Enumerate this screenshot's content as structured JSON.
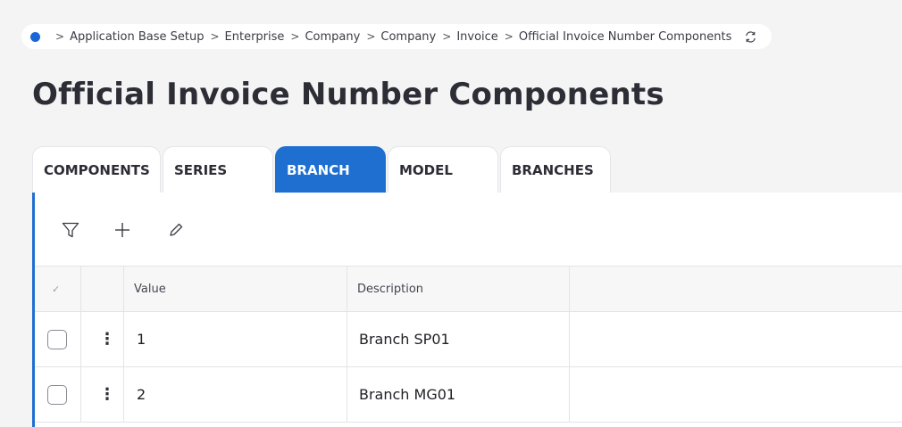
{
  "breadcrumb": {
    "items": [
      "Application Base Setup",
      "Enterprise",
      "Company",
      "Company",
      "Invoice",
      "Official Invoice Number Components"
    ],
    "separator": ">"
  },
  "page": {
    "title": "Official Invoice Number Components"
  },
  "tabs": [
    {
      "label": "COMPONENTS",
      "active": false
    },
    {
      "label": "SERIES",
      "active": false
    },
    {
      "label": "BRANCH",
      "active": true
    },
    {
      "label": "MODEL",
      "active": false
    },
    {
      "label": "BRANCHES",
      "active": false
    }
  ],
  "toolbar": {
    "icons": [
      "filter-icon",
      "add-icon",
      "edit-icon"
    ]
  },
  "grid": {
    "header_check": "✓",
    "columns": [
      "Value",
      "Description"
    ],
    "rows": [
      {
        "value": "1",
        "description": "Branch SP01"
      },
      {
        "value": "2",
        "description": "Branch MG01"
      }
    ]
  },
  "colors": {
    "accent": "#1f6fd1",
    "dot": "#1a66d9"
  }
}
